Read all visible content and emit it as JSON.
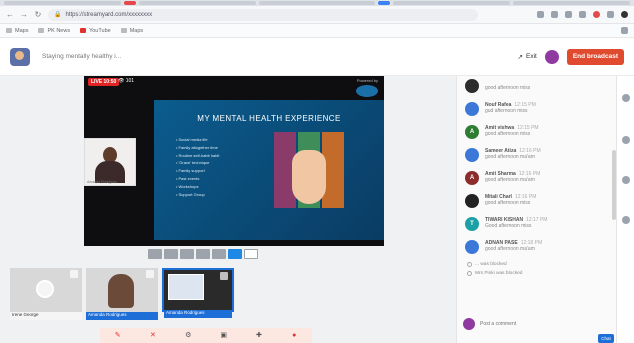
{
  "browser": {
    "url": "https://streamyard.com/xxxxxxxx",
    "bookmarks": [
      "Maps",
      "PK News",
      "YouTube",
      "Maps"
    ]
  },
  "header": {
    "event_title": "Staying mentally healthy i...",
    "exit_label": "Exit",
    "end_button": "End broadcast"
  },
  "stage": {
    "live_label": "LIVE 10:50",
    "viewers": "101",
    "powered_by": "Powered by",
    "slide_title": "MY MENTAL HEALTH EXPERIENCE",
    "slide_bullets": [
      "Social media life",
      "Family altogether time",
      "Routine self-habit habit",
      "'Grace' technique",
      "Family support",
      "Past events",
      "Workshops",
      "Support Group"
    ],
    "speaker_tag": "Amanda Rodrigues"
  },
  "thumbs": [
    {
      "label": "Irene George"
    },
    {
      "label": "Amanda Rodrigues"
    },
    {
      "label": "Amanda Rodrigues"
    }
  ],
  "chat": {
    "messages": [
      {
        "initial": "",
        "name": "",
        "time": "",
        "text": "good afternoon miss",
        "color": "#2d2d2d"
      },
      {
        "initial": "",
        "name": "Nouf Rafea",
        "time": "12:15 PM",
        "text": "gud afternoon miss",
        "color": "#3b78d8"
      },
      {
        "initial": "A",
        "name": "Amit vishwa",
        "time": "12:15 PM",
        "text": "good afternoon miss",
        "color": "#2f7d32"
      },
      {
        "initial": "",
        "name": "Sameer Atiza",
        "time": "12:16 PM",
        "text": "good afternoon ma'am",
        "color": "#3b78d8"
      },
      {
        "initial": "A",
        "name": "Amit Sharma",
        "time": "12:16 PM",
        "text": "good afternoon ma'am",
        "color": "#8d2c2c"
      },
      {
        "initial": "",
        "name": "Mitali Charl",
        "time": "12:16 PM",
        "text": "good afternoon miss",
        "color": "#222"
      },
      {
        "initial": "T",
        "name": "TIWARI KISHAN",
        "time": "12:17 PM",
        "text": "Good afternoon miss",
        "color": "#1aa0a5"
      },
      {
        "initial": "",
        "name": "ADNAN PASE",
        "time": "12:18 PM",
        "text": "good afternoon ma'am",
        "color": "#3b78d8"
      }
    ],
    "system": [
      "... was blocked",
      "Mrs Pinki was blocked"
    ],
    "comment_placeholder": "Post a comment",
    "send": "Chat"
  }
}
